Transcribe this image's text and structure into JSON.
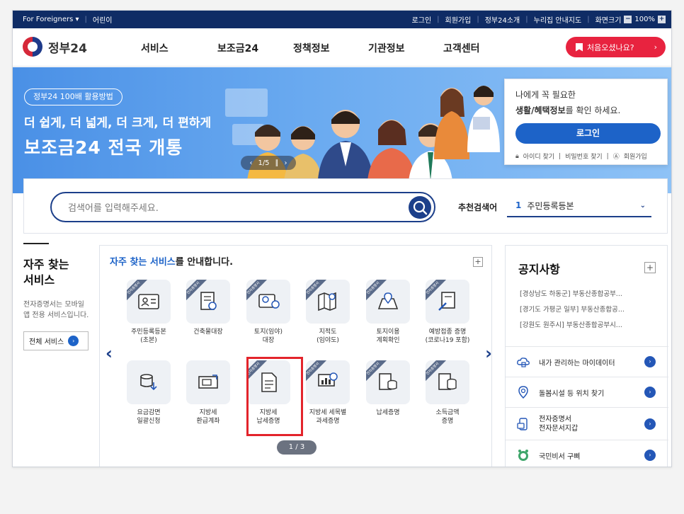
{
  "topbar": {
    "foreigners": "For Foreigners ▾",
    "kids": "어린이",
    "login": "로그인",
    "join": "회원가입",
    "intro": "정부24소개",
    "sitemap": "누리집 안내지도",
    "zoom_label": "화면크기",
    "zoom_value": "100%"
  },
  "header": {
    "logo": "정부24",
    "nav": [
      "서비스",
      "보조금24",
      "정책정보",
      "기관정보",
      "고객센터"
    ],
    "first_visit": "처음오셨나요?"
  },
  "banner": {
    "pill": "정부24 100배 활용방법",
    "line1": "더 쉽게, 더 넓게, 더 크게, 더 편하게",
    "line2": "보조금24 전국 개통",
    "pager": "1/5"
  },
  "login_card": {
    "line1": "나에게 꼭 필요한",
    "line2_bold": "생활/혜택정보",
    "line2_rest": "를 확인 하세요.",
    "button": "로그인",
    "find_id": "아이디 찾기",
    "find_pw": "비밀번호 찾기",
    "join": "회원가입"
  },
  "search": {
    "placeholder": "검색어를 입력해주세요.",
    "rec_label": "추천검색어",
    "rec_num": "1",
    "rec_value": "주민등록등본"
  },
  "frequent": {
    "title_l1": "자주 찾는",
    "title_l2": "서비스",
    "desc": "전자증명서는 모바일 앱 전용 서비스입니다.",
    "all_button": "전체 서비스"
  },
  "services": {
    "head_hl": "자주 찾는 서비스",
    "head_rest": "를 안내합니다.",
    "ribbon": "전자증명서",
    "items": [
      {
        "l1": "주민등록등본",
        "l2": "(초본)",
        "icon": "id-card-icon"
      },
      {
        "l1": "건축물대장",
        "l2": "",
        "icon": "building-doc-icon"
      },
      {
        "l1": "토지(임야)",
        "l2": "대장",
        "icon": "land-ledger-icon"
      },
      {
        "l1": "지적도",
        "l2": "(임야도)",
        "icon": "map-icon"
      },
      {
        "l1": "토지이용",
        "l2": "계획확인",
        "icon": "land-plan-icon"
      },
      {
        "l1": "예방접종 증명",
        "l2": "(코로나19 포함)",
        "icon": "vaccine-icon"
      },
      {
        "l1": "요금감면",
        "l2": "일괄신청",
        "icon": "coin-down-icon"
      },
      {
        "l1": "지방세",
        "l2": "환급계좌",
        "icon": "refund-icon"
      },
      {
        "l1": "지방세",
        "l2": "납세증명",
        "icon": "document-icon"
      },
      {
        "l1": "지방세 세목별",
        "l2": "과세증명",
        "icon": "chart-board-icon"
      },
      {
        "l1": "납세증명",
        "l2": "",
        "icon": "tax-cert-icon"
      },
      {
        "l1": "소득금액",
        "l2": "증명",
        "icon": "income-cert-icon"
      }
    ],
    "pager": "1 / 3"
  },
  "notice": {
    "title": "공지사항",
    "items": [
      "[경상남도 하동군] 부동산종합공부...",
      "[경기도 가평군 일부] 부동산종합공...",
      "[강원도 원주시] 부동산종합공부시..."
    ]
  },
  "quick_links": [
    {
      "label": "내가 관리하는 마이데이터",
      "label2": ""
    },
    {
      "label": "돌봄시설 등 위치 찾기",
      "label2": ""
    },
    {
      "label": "전자증명서",
      "label2": "전자문서지갑"
    },
    {
      "label": "국민비서 구삐",
      "label2": ""
    }
  ],
  "colors": {
    "navy": "#0f2c65",
    "blue": "#1d63c8",
    "red": "#e8233f"
  }
}
